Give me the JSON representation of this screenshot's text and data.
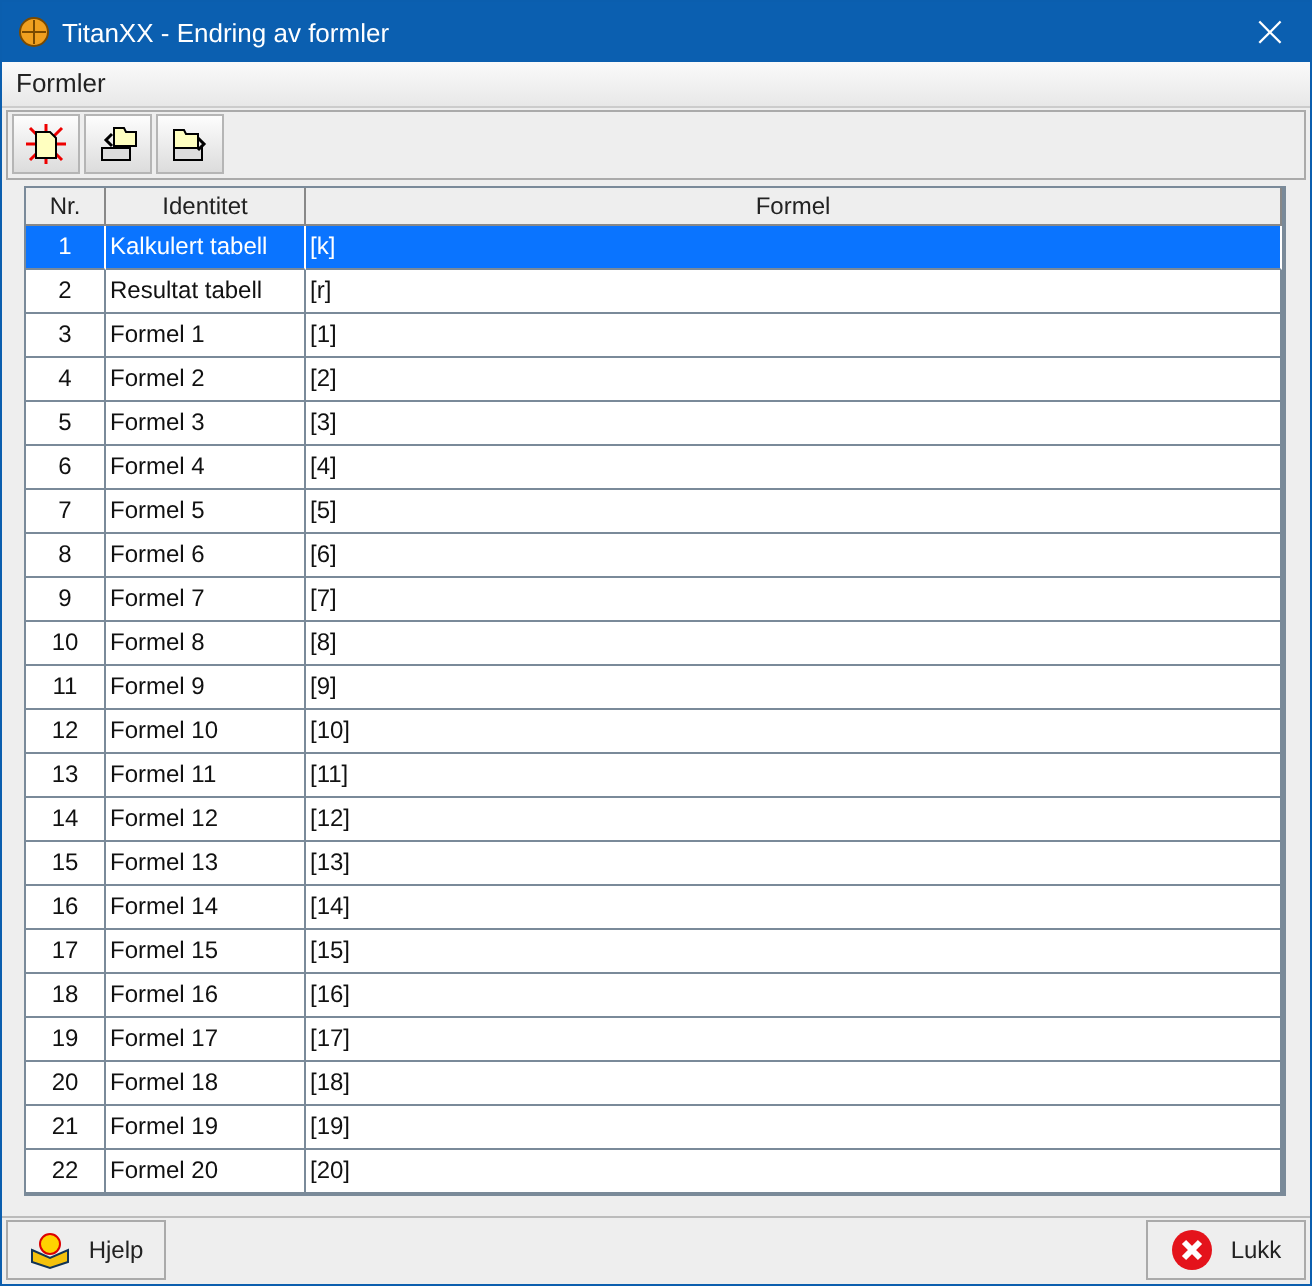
{
  "window": {
    "title": "TitanXX - Endring av formler",
    "close": "×"
  },
  "menu": [
    "Formler"
  ],
  "table": {
    "columns": [
      "Nr.",
      "Identitet",
      "Formel"
    ],
    "rows": [
      {
        "nr": "1",
        "identity": "Kalkulert tabell",
        "formula": "[k]",
        "selected": true
      },
      {
        "nr": "2",
        "identity": "Resultat tabell",
        "formula": "[r]",
        "selected": false
      },
      {
        "nr": "3",
        "identity": "Formel 1",
        "formula": "[1]",
        "selected": false
      },
      {
        "nr": "4",
        "identity": "Formel 2",
        "formula": "[2]",
        "selected": false
      },
      {
        "nr": "5",
        "identity": "Formel 3",
        "formula": "[3]",
        "selected": false
      },
      {
        "nr": "6",
        "identity": "Formel 4",
        "formula": "[4]",
        "selected": false
      },
      {
        "nr": "7",
        "identity": "Formel 5",
        "formula": "[5]",
        "selected": false
      },
      {
        "nr": "8",
        "identity": "Formel 6",
        "formula": "[6]",
        "selected": false
      },
      {
        "nr": "9",
        "identity": "Formel 7",
        "formula": "[7]",
        "selected": false
      },
      {
        "nr": "10",
        "identity": "Formel 8",
        "formula": "[8]",
        "selected": false
      },
      {
        "nr": "11",
        "identity": "Formel 9",
        "formula": "[9]",
        "selected": false
      },
      {
        "nr": "12",
        "identity": "Formel 10",
        "formula": "[10]",
        "selected": false
      },
      {
        "nr": "13",
        "identity": "Formel 11",
        "formula": "[11]",
        "selected": false
      },
      {
        "nr": "14",
        "identity": "Formel 12",
        "formula": "[12]",
        "selected": false
      },
      {
        "nr": "15",
        "identity": "Formel 13",
        "formula": "[13]",
        "selected": false
      },
      {
        "nr": "16",
        "identity": "Formel 14",
        "formula": "[14]",
        "selected": false
      },
      {
        "nr": "17",
        "identity": "Formel 15",
        "formula": "[15]",
        "selected": false
      },
      {
        "nr": "18",
        "identity": "Formel 16",
        "formula": "[16]",
        "selected": false
      },
      {
        "nr": "19",
        "identity": "Formel 17",
        "formula": "[17]",
        "selected": false
      },
      {
        "nr": "20",
        "identity": "Formel 18",
        "formula": "[18]",
        "selected": false
      },
      {
        "nr": "21",
        "identity": "Formel 19",
        "formula": "[19]",
        "selected": false
      },
      {
        "nr": "22",
        "identity": "Formel 20",
        "formula": "[20]",
        "selected": false
      }
    ]
  },
  "buttons": [
    {
      "label": "Hjelp",
      "kind": "help"
    },
    {
      "label": "Lukk",
      "kind": "close"
    }
  ]
}
